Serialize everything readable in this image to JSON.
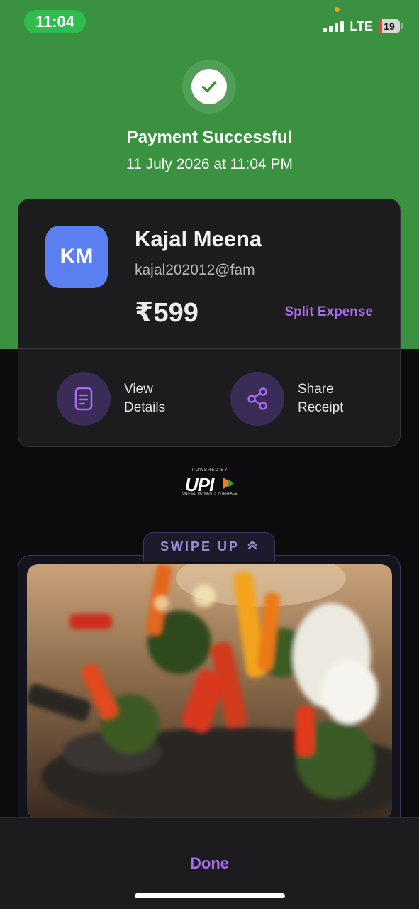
{
  "status_bar": {
    "time": "11:04",
    "network": "LTE",
    "battery": "19"
  },
  "header": {
    "title": "Payment Successful",
    "datetime": "11 July 2026 at 11:04 PM"
  },
  "payee": {
    "initials": "KM",
    "name": "Kajal Meena",
    "upi_id": "kajal202012@fam",
    "amount": "₹599",
    "split_label": "Split Expense"
  },
  "actions": [
    {
      "label": "View\nDetails",
      "icon": "document-icon"
    },
    {
      "label": "Share\nReceipt",
      "icon": "share-icon"
    }
  ],
  "upi_logo": {
    "powered": "POWERED BY",
    "mark": "UPI",
    "sub": "UNIFIED PAYMENTS INTERFACE"
  },
  "promo": {
    "swipe_label": "SWIPE UP",
    "icon": "chevrons-up-icon"
  },
  "footer": {
    "done_label": "Done"
  },
  "colors": {
    "success_green": "#3a913f",
    "accent_purple": "#a86cf0",
    "avatar_blue": "#5b7ff0",
    "card_bg": "#1c1c1f"
  }
}
